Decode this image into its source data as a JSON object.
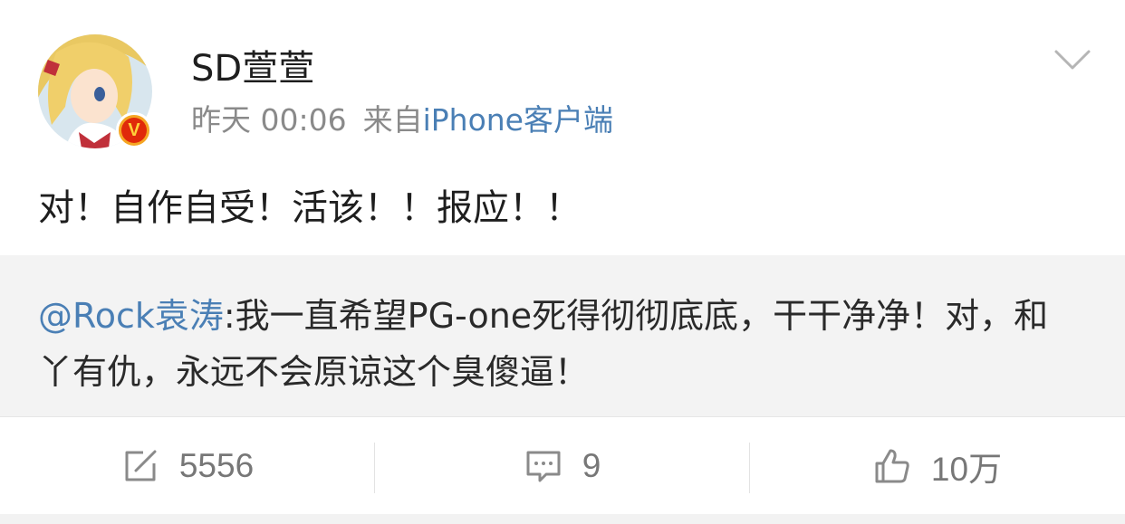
{
  "post": {
    "username": "SD萱萱",
    "time": "昨天 00:06",
    "source_prefix": "来自",
    "source_client": "iPhone客户端",
    "verified_badge": "V",
    "text": "对！自作自受！活该！！报应！！"
  },
  "repost": {
    "mention": "@Rock袁涛",
    "text": ":我一直希望PG-one死得彻彻底底，干干净净！对，和丫有仇，永远不会原谅这个臭傻逼！"
  },
  "actions": {
    "repost_count": "5556",
    "comment_count": "9",
    "like_count": "10万"
  },
  "icons": {
    "repost": "edit-square-icon",
    "comment": "comment-bubble-icon",
    "like": "thumbs-up-icon",
    "menu": "chevron-down-icon"
  },
  "colors": {
    "link": "#4a7fb5",
    "repost_bg": "#f3f3f3",
    "badge_outer": "#f5a623",
    "badge_inner": "#e02a0a"
  }
}
